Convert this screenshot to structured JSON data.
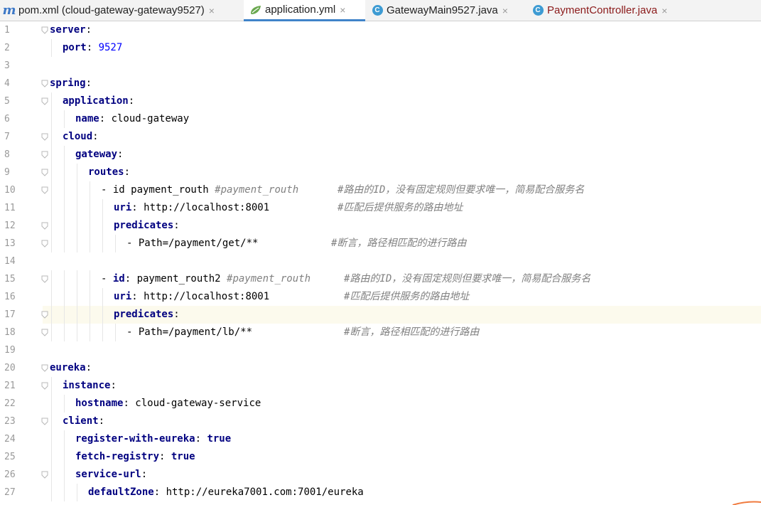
{
  "tabs": [
    {
      "label": "pom.xml (cloud-gateway-gateway9527)",
      "icon": "maven-icon",
      "active": false
    },
    {
      "label": "application.yml",
      "icon": "spring-yml-icon",
      "active": true
    },
    {
      "label": "GatewayMain9527.java",
      "icon": "java-class-icon",
      "active": false
    },
    {
      "label": "PaymentController.java",
      "icon": "java-class-icon",
      "active": false
    }
  ],
  "tab_close": "×",
  "lines": [
    {
      "num": "1",
      "indent": 0,
      "key": "server",
      "sep": ":",
      "val": "",
      "val_type": "",
      "comment": "",
      "comment_col": 0
    },
    {
      "num": "2",
      "indent": 1,
      "key": "port",
      "sep": ": ",
      "val": "9527",
      "val_type": "num",
      "comment": "",
      "comment_col": 0
    },
    {
      "num": "3",
      "indent": 0,
      "key": "",
      "sep": "",
      "val": "",
      "val_type": "",
      "comment": "",
      "comment_col": 0
    },
    {
      "num": "4",
      "indent": 0,
      "key": "spring",
      "sep": ":",
      "val": "",
      "val_type": "",
      "comment": "",
      "comment_col": 0
    },
    {
      "num": "5",
      "indent": 1,
      "key": "application",
      "sep": ":",
      "val": "",
      "val_type": "",
      "comment": "",
      "comment_col": 0
    },
    {
      "num": "6",
      "indent": 2,
      "key": "name",
      "sep": ": ",
      "val": "cloud-gateway",
      "val_type": "v",
      "comment": "",
      "comment_col": 0
    },
    {
      "num": "7",
      "indent": 1,
      "key": "cloud",
      "sep": ":",
      "val": "",
      "val_type": "",
      "comment": "",
      "comment_col": 0
    },
    {
      "num": "8",
      "indent": 2,
      "key": "gateway",
      "sep": ":",
      "val": "",
      "val_type": "",
      "comment": "",
      "comment_col": 0
    },
    {
      "num": "9",
      "indent": 3,
      "key": "routes",
      "sep": ":",
      "val": "",
      "val_type": "",
      "comment": "",
      "comment_col": 0
    },
    {
      "num": "10",
      "indent": 4,
      "prefix": "- ",
      "key": "",
      "sep": "",
      "val": "id payment_routh ",
      "val_type": "v",
      "extra": "#payment_routh",
      "comment": "#路由的ID，没有固定规则但要求唯一，简易配合服务名",
      "comment_col": 405
    },
    {
      "num": "11",
      "indent": 5,
      "key": "uri",
      "sep": ": ",
      "val": "http://localhost:8001",
      "val_type": "v",
      "comment": "#匹配后提供服务的路由地址",
      "comment_col": 405
    },
    {
      "num": "12",
      "indent": 5,
      "key": "predicates",
      "sep": ":",
      "val": "",
      "val_type": "",
      "comment": "",
      "comment_col": 0
    },
    {
      "num": "13",
      "indent": 6,
      "prefix": "- ",
      "key": "",
      "sep": "",
      "val": "Path=/payment/get/**",
      "val_type": "v",
      "comment": "#断言，路径相匹配的进行路由",
      "comment_col": 396
    },
    {
      "num": "14",
      "indent": 0,
      "key": "",
      "sep": "",
      "val": "",
      "val_type": "",
      "comment": "",
      "comment_col": 0
    },
    {
      "num": "15",
      "indent": 4,
      "prefix": "- ",
      "key": "id",
      "sep": ": ",
      "val": "payment_routh2 ",
      "val_type": "v",
      "extra": "#payment_routh",
      "comment": "#路由的ID，没有固定规则但要求唯一，简易配合服务名",
      "comment_col": 414
    },
    {
      "num": "16",
      "indent": 5,
      "key": "uri",
      "sep": ": ",
      "val": "http://localhost:8001",
      "val_type": "v",
      "comment": "#匹配后提供服务的路由地址",
      "comment_col": 414
    },
    {
      "num": "17",
      "indent": 5,
      "key": "predicates",
      "sep": ":",
      "val": "",
      "val_type": "",
      "comment": "",
      "comment_col": 0
    },
    {
      "num": "18",
      "indent": 6,
      "prefix": "- ",
      "key": "",
      "sep": "",
      "val": "Path=/payment/lb/**",
      "val_type": "v",
      "comment": "#断言，路径相匹配的进行路由",
      "comment_col": 414
    },
    {
      "num": "19",
      "indent": 0,
      "key": "",
      "sep": "",
      "val": "",
      "val_type": "",
      "comment": "",
      "comment_col": 0
    },
    {
      "num": "20",
      "indent": 0,
      "key": "eureka",
      "sep": ":",
      "val": "",
      "val_type": "",
      "comment": "",
      "comment_col": 0
    },
    {
      "num": "21",
      "indent": 1,
      "key": "instance",
      "sep": ":",
      "val": "",
      "val_type": "",
      "comment": "",
      "comment_col": 0
    },
    {
      "num": "22",
      "indent": 2,
      "key": "hostname",
      "sep": ": ",
      "val": "cloud-gateway-service",
      "val_type": "v",
      "comment": "",
      "comment_col": 0
    },
    {
      "num": "23",
      "indent": 1,
      "key": "client",
      "sep": ":",
      "val": "",
      "val_type": "",
      "comment": "",
      "comment_col": 0
    },
    {
      "num": "24",
      "indent": 2,
      "key": "register-with-eureka",
      "sep": ": ",
      "val": "true",
      "val_type": "bool",
      "comment": "",
      "comment_col": 0
    },
    {
      "num": "25",
      "indent": 2,
      "key": "fetch-registry",
      "sep": ": ",
      "val": "true",
      "val_type": "bool",
      "comment": "",
      "comment_col": 0
    },
    {
      "num": "26",
      "indent": 2,
      "key": "service-url",
      "sep": ":",
      "val": "",
      "val_type": "",
      "comment": "",
      "comment_col": 0
    },
    {
      "num": "27",
      "indent": 3,
      "key": "defaultZone",
      "sep": ": ",
      "val": "http://eureka7001.com:7001/eureka",
      "val_type": "v",
      "comment": "",
      "comment_col": 0
    }
  ],
  "highlighted_line": "17",
  "colors": {
    "key": "#000080",
    "number": "#0000ff",
    "comment": "#808080",
    "active_tab": "#4083c9",
    "line_highlight": "#fcfaed"
  }
}
